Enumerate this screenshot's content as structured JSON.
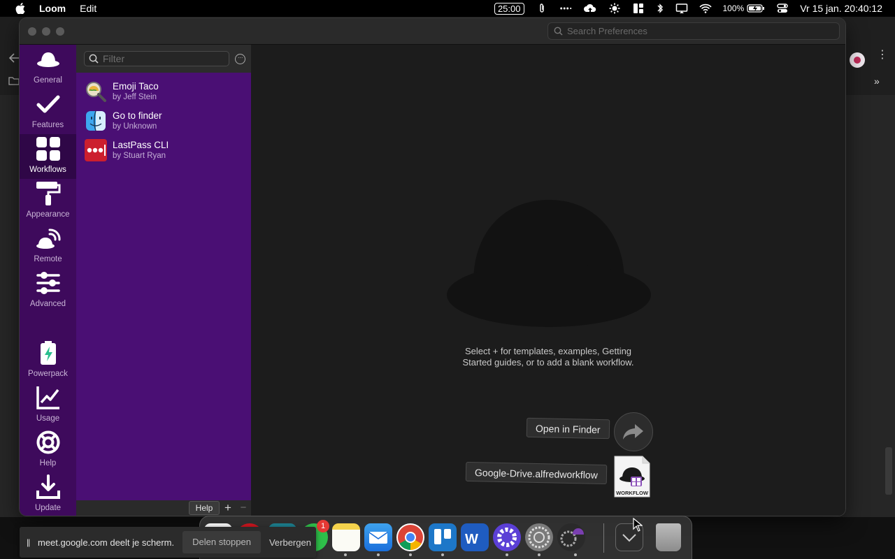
{
  "menubar": {
    "app_name": "Loom",
    "menus": [
      "Edit"
    ],
    "timer": "25:00",
    "battery": "100%",
    "clock": "Vr 15 jan.  20:40:12",
    "icons": [
      "apple-icon",
      "paperclip-icon",
      "dots-icon",
      "cloud-upload-icon",
      "brightness-icon",
      "layout-icon",
      "bluetooth-icon",
      "display-icon",
      "wifi-icon",
      "battery-icon",
      "control-center-icon"
    ]
  },
  "window": {
    "search_placeholder": "Search Preferences"
  },
  "sidebar": {
    "items": [
      {
        "label": "General",
        "icon": "hat-icon"
      },
      {
        "label": "Features",
        "icon": "checkmark-icon"
      },
      {
        "label": "Workflows",
        "icon": "grid-icon",
        "active": true
      },
      {
        "label": "Appearance",
        "icon": "paint-roller-icon"
      },
      {
        "label": "Remote",
        "icon": "remote-icon"
      },
      {
        "label": "Advanced",
        "icon": "sliders-icon"
      },
      {
        "label": "Powerpack",
        "icon": "battery-bolt-icon"
      },
      {
        "label": "Usage",
        "icon": "chart-icon"
      },
      {
        "label": "Help",
        "icon": "lifebuoy-icon"
      },
      {
        "label": "Update",
        "icon": "download-icon"
      }
    ]
  },
  "workflows": {
    "filter_placeholder": "Filter",
    "items": [
      {
        "name": "Emoji Taco",
        "author": "by Jeff Stein",
        "icon": "taco-magnifier-icon"
      },
      {
        "name": "Go to finder",
        "author": "by Unknown",
        "icon": "finder-icon"
      },
      {
        "name": "LastPass CLI",
        "author": "by Stuart Ryan",
        "icon": "lastpass-icon"
      }
    ],
    "help_label": "Help",
    "add_label": "+",
    "remove_label": "−"
  },
  "main": {
    "empty_line1": "Select + for templates, examples, Getting",
    "empty_line2": "Started guides, or to add a blank workflow."
  },
  "drag": {
    "open_in_finder": "Open in Finder",
    "filename": "Google-Drive.alfredworkflow",
    "file_label": "WORKFLOW"
  },
  "dock": {
    "badge": "1",
    "apps": [
      "safari",
      "opera",
      "teams",
      "whatsapp",
      "notes",
      "mail",
      "chrome",
      "trello",
      "word",
      "alfred",
      "system-preferences",
      "alfred-preferences",
      "downloads",
      "trash"
    ]
  },
  "sharebar": {
    "pause_glyph": "||",
    "text": "meet.google.com deelt je scherm.",
    "stop_label": "Delen stoppen",
    "hide_label": "Verbergen"
  },
  "colors": {
    "sidebar": "#3e0a5c",
    "sidebar_active": "#2f0747",
    "workflow_panel": "#4a0f74",
    "main_bg": "#1c1c1c"
  }
}
